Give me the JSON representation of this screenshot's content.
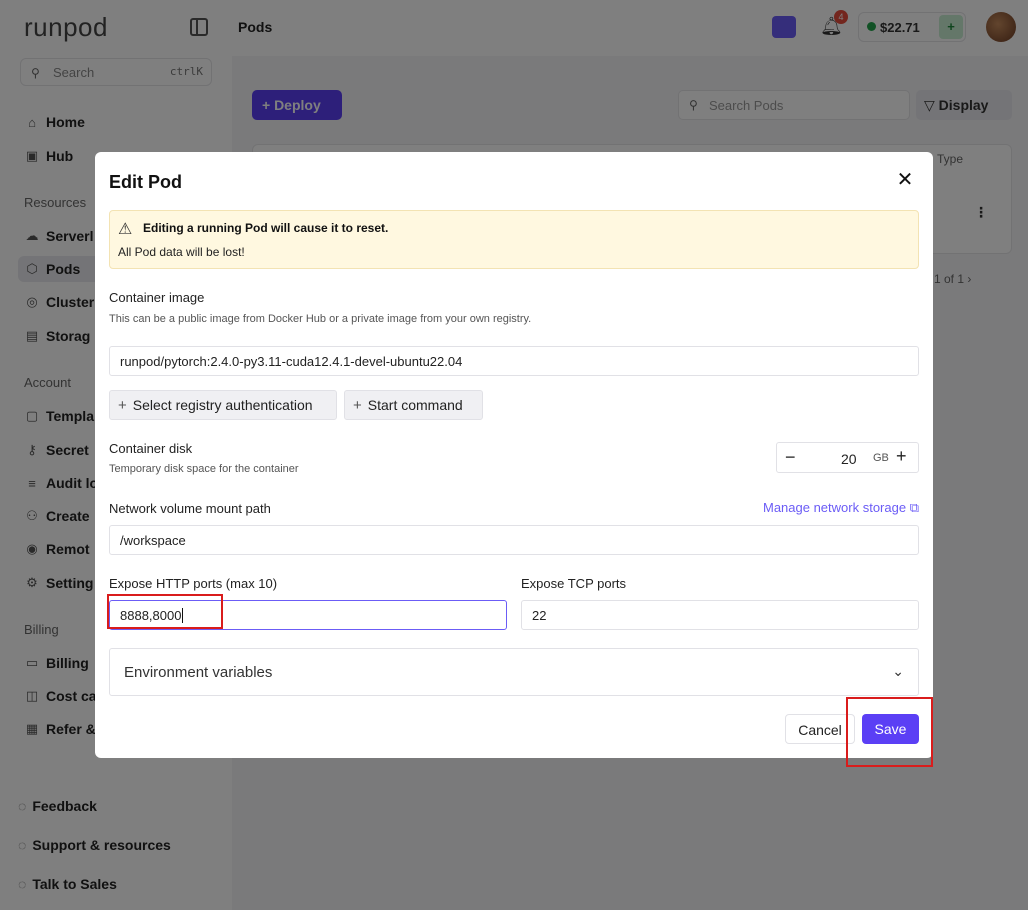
{
  "app": {
    "logo": "runpod",
    "page_title": "Pods",
    "search": {
      "placeholder": "Search",
      "shortcut": "ctrlK"
    },
    "nav": {
      "home": "Home",
      "hub": "Hub",
      "resources_section": "Resources",
      "serverless": "Serverl",
      "pods": "Pods",
      "clusters": "Cluster",
      "storage": "Storag",
      "account_section": "Account",
      "templates": "Templa",
      "secrets": "Secret",
      "audit_logs": "Audit lo",
      "create": "Create",
      "remote": "Remot",
      "settings": "Setting",
      "billing_section": "Billing",
      "billing": "Billing",
      "cost": "Cost ca",
      "refer": "Refer &"
    },
    "bottom": {
      "feedback": "Feedback",
      "support": "Support & resources",
      "sales": "Talk to Sales"
    },
    "topbar": {
      "notifications_count": "4",
      "balance": "$22.71"
    },
    "main": {
      "deploy_label": "+ Deploy",
      "search_placeholder": "Search Pods",
      "display_label": "Display",
      "col_type": "Type",
      "pager": "1 of 1"
    }
  },
  "modal": {
    "title": "Edit Pod",
    "warning": {
      "title": "Editing a running Pod will cause it to reset.",
      "body": "All Pod data will be lost!"
    },
    "container_image": {
      "label": "Container image",
      "help": "This can be a public image from Docker Hub or a private image from your own registry.",
      "value": "runpod/pytorch:2.4.0-py3.11-cuda12.4.1-devel-ubuntu22.04"
    },
    "buttons": {
      "registry_auth": "Select registry authentication",
      "start_command": "Start command",
      "cancel": "Cancel",
      "save": "Save"
    },
    "container_disk": {
      "label": "Container disk",
      "help": "Temporary disk space for the container",
      "value": "20",
      "unit": "GB"
    },
    "network_volume": {
      "label": "Network volume mount path",
      "manage_link": "Manage network storage",
      "value": "/workspace"
    },
    "http_ports": {
      "label": "Expose HTTP ports (max 10)",
      "value": "8888,8000"
    },
    "tcp_ports": {
      "label": "Expose TCP ports",
      "value": "22"
    },
    "env_vars": {
      "label": "Environment variables"
    }
  },
  "colors": {
    "accent": "#5b3ff5",
    "link": "#6b5cf6",
    "warning_bg": "#fff8e0",
    "highlight": "#d91c1c"
  }
}
